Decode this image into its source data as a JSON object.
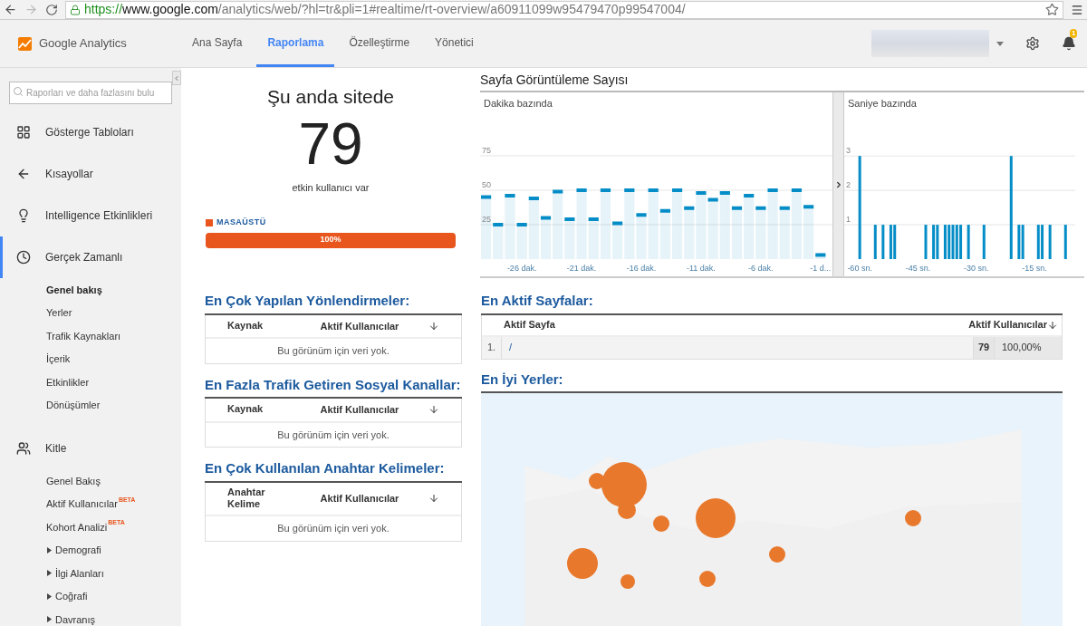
{
  "browser": {
    "url": {
      "scheme": "https://",
      "host": "www.google.com",
      "path": "/analytics/web/?hl=tr&pli=1#realtime/rt-overview/a60911099w95479470p99547004/"
    }
  },
  "header": {
    "logo": "Google Analytics",
    "tabs": [
      {
        "label": "Ana Sayfa",
        "selected": false
      },
      {
        "label": "Raporlama",
        "selected": true
      },
      {
        "label": "Özelleştirme",
        "selected": false
      },
      {
        "label": "Yönetici",
        "selected": false
      }
    ],
    "notifications": "1"
  },
  "sidebar": {
    "search": {
      "placeholder": "Raporları ve daha fazlasını bulu"
    },
    "items": [
      {
        "label": "Gösterge Tabloları",
        "selected": false
      },
      {
        "label": "Kısayollar",
        "selected": false
      },
      {
        "label": "Intelligence Etkinlikleri",
        "selected": false
      },
      {
        "label": "Gerçek Zamanlı",
        "selected": true,
        "children": [
          {
            "kind": "link",
            "label": "Genel bakış",
            "selected": true
          },
          {
            "kind": "link",
            "label": "Yerler",
            "selected": false
          },
          {
            "kind": "link",
            "label": "Trafik Kaynakları",
            "selected": false
          },
          {
            "kind": "link",
            "label": "İçerik",
            "selected": false
          },
          {
            "kind": "link",
            "label": "Etkinlikler",
            "selected": false
          },
          {
            "kind": "link",
            "label": "Dönüşümler",
            "selected": false
          }
        ]
      },
      {
        "label": "Kitle",
        "selected": false,
        "children": [
          {
            "kind": "link",
            "label": "Genel Bakış",
            "selected": false
          },
          {
            "kind": "link",
            "label": "Aktif Kullanıcılar",
            "badge": "BETA",
            "selected": false
          },
          {
            "kind": "link",
            "label": "Kohort Analizi",
            "badge": "BETA",
            "selected": false
          },
          {
            "kind": "group",
            "label": "Demografi",
            "expanded": false,
            "selected": false
          },
          {
            "kind": "group",
            "label": "İlgi Alanları",
            "expanded": false,
            "selected": false
          },
          {
            "kind": "group",
            "label": "Coğrafi",
            "expanded": false,
            "selected": false
          },
          {
            "kind": "group",
            "label": "Davranış",
            "expanded": false,
            "selected": false
          }
        ]
      }
    ]
  },
  "realtime": {
    "title": "Şu anda sitede",
    "count": "79",
    "caption": "etkin kullanıcı var",
    "devices": [
      {
        "label": "MASAÜSTÜ",
        "color": "#e8561e",
        "level": 1,
        "reading": "100%"
      }
    ]
  },
  "pageviews": {
    "title": "Sayfa Görüntüleme Sayısı",
    "per_minute": {
      "subtitle": "Dakika bazında",
      "chart_data": {
        "type": "bar",
        "x": [
          -29,
          -28,
          -27,
          -26,
          -25,
          -24,
          -23,
          -22,
          -21,
          -20,
          -19,
          -18,
          -17,
          -16,
          -15,
          -14,
          -13,
          -12,
          -11,
          -10,
          -9,
          -8,
          -7,
          -6,
          -5,
          -4,
          -3,
          -2,
          -1
        ],
        "series": [
          {
            "color": "#058dc7",
            "values": [
              45,
              25,
              46,
              25,
              44,
              30,
              49,
              29,
              50,
              29,
              50,
              26,
              50,
              32,
              50,
              35,
              50,
              37,
              48,
              43,
              48,
              37,
              46,
              37,
              50,
              37,
              50,
              38,
              3
            ]
          }
        ],
        "xlim": [
          -29.5,
          0
        ],
        "ylim": [
          0,
          121
        ],
        "yticks": [
          25,
          50,
          75
        ],
        "grid": true,
        "xticks": [
          {
            "value": -26,
            "label": "-26 dak."
          },
          {
            "value": -21,
            "label": "-21 dak."
          },
          {
            "value": -16,
            "label": "-16 dak."
          },
          {
            "value": -11,
            "label": "-11 dak."
          },
          {
            "value": -6,
            "label": "-6 dak."
          },
          {
            "value": -1,
            "label": "-1 d..."
          }
        ]
      }
    },
    "per_second": {
      "subtitle": "Saniye bazında",
      "chart_data": {
        "type": "bar",
        "x": [
          -60,
          -59,
          -58,
          -57,
          -56,
          -55,
          -54,
          -53,
          -52,
          -51,
          -50,
          -49,
          -48,
          -47,
          -46,
          -45,
          -44,
          -43,
          -42,
          -41,
          -40,
          -39,
          -38,
          -37,
          -36,
          -35,
          -34,
          -33,
          -32,
          -31,
          -30,
          -29,
          -28,
          -27,
          -26,
          -25,
          -24,
          -23,
          -22,
          -21,
          -20,
          -19,
          -18,
          -17,
          -16,
          -15,
          -14,
          -13,
          -12,
          -11,
          -10,
          -9,
          -8,
          -7,
          -6,
          -5
        ],
        "series": [
          {
            "color": "#058dc7",
            "values": [
              3,
              0,
              0,
              0,
              1,
              0,
              1,
              0,
              1,
              1,
              0,
              0,
              0,
              0,
              0,
              0,
              0,
              1,
              0,
              1,
              1,
              0,
              1,
              1,
              1,
              1,
              1,
              0,
              1,
              0,
              0,
              0,
              1,
              0,
              0,
              0,
              0,
              0,
              0,
              3,
              0,
              1,
              1,
              0,
              0,
              0,
              1,
              1,
              0,
              1,
              0,
              0,
              0,
              1,
              0,
              0
            ]
          }
        ],
        "xlim": [
          -64,
          -4.5
        ],
        "ylim": [
          0,
          4.85
        ],
        "yticks": [
          1,
          2,
          3
        ],
        "grid": true,
        "xticks": [
          {
            "value": -60,
            "label": "-60 sn."
          },
          {
            "value": -45,
            "label": "-45 sn."
          },
          {
            "value": -30,
            "label": "-30 sn."
          },
          {
            "value": -15,
            "label": "-15 sn."
          }
        ]
      }
    }
  },
  "tables": [
    {
      "title": "En Çok Yapılan Yönlendirmeler:",
      "columns": [
        "Kaynak",
        "Aktif Kullanıcılar"
      ],
      "empty": "Bu görünüm için veri yok."
    },
    {
      "title": "En Fazla Trafik Getiren Sosyal Kanallar:",
      "columns": [
        "Kaynak",
        "Aktif Kullanıcılar"
      ],
      "empty": "Bu görünüm için veri yok."
    },
    {
      "title": "En Çok Kullanılan Anahtar Kelimeler:",
      "columns": [
        "Anahtar Kelime",
        "Aktif Kullanıcılar"
      ],
      "empty": "Bu görünüm için veri yok."
    }
  ],
  "active_pages": {
    "title": "En Aktif Sayfalar:",
    "columns": [
      "Aktif Sayfa",
      "Aktif Kullanıcılar"
    ],
    "rows": [
      {
        "index": "1.",
        "page": "/",
        "users": "79",
        "percent": "100,00%"
      }
    ]
  },
  "locations": {
    "title": "En İyi Yerler:"
  }
}
